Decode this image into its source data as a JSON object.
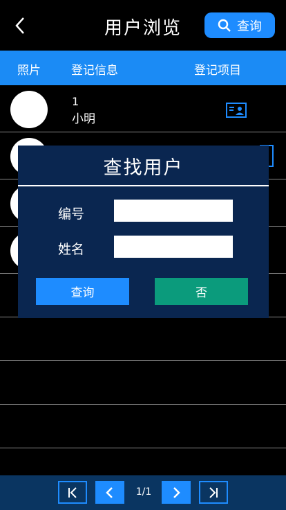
{
  "header": {
    "title": "用户浏览",
    "search_label": "查询"
  },
  "table": {
    "columns": [
      "照片",
      "登记信息",
      "登记项目"
    ],
    "rows": [
      {
        "number": "1",
        "name": "小明"
      },
      {
        "number": "",
        "name": ""
      },
      {
        "number": "",
        "name": ""
      },
      {
        "number": "",
        "name": ""
      }
    ]
  },
  "pagination": {
    "current": "1/1"
  },
  "dialog": {
    "title": "查找用户",
    "fields": [
      {
        "label": "编号",
        "value": ""
      },
      {
        "label": "姓名",
        "value": ""
      }
    ],
    "query_label": "查询",
    "no_label": "否"
  },
  "colors": {
    "accent": "#1e8cff",
    "header_row": "#1b8bf5",
    "dialog_bg": "#0a2650",
    "bottom_bar": "#0a3561",
    "no_button": "#0b9b7c"
  }
}
